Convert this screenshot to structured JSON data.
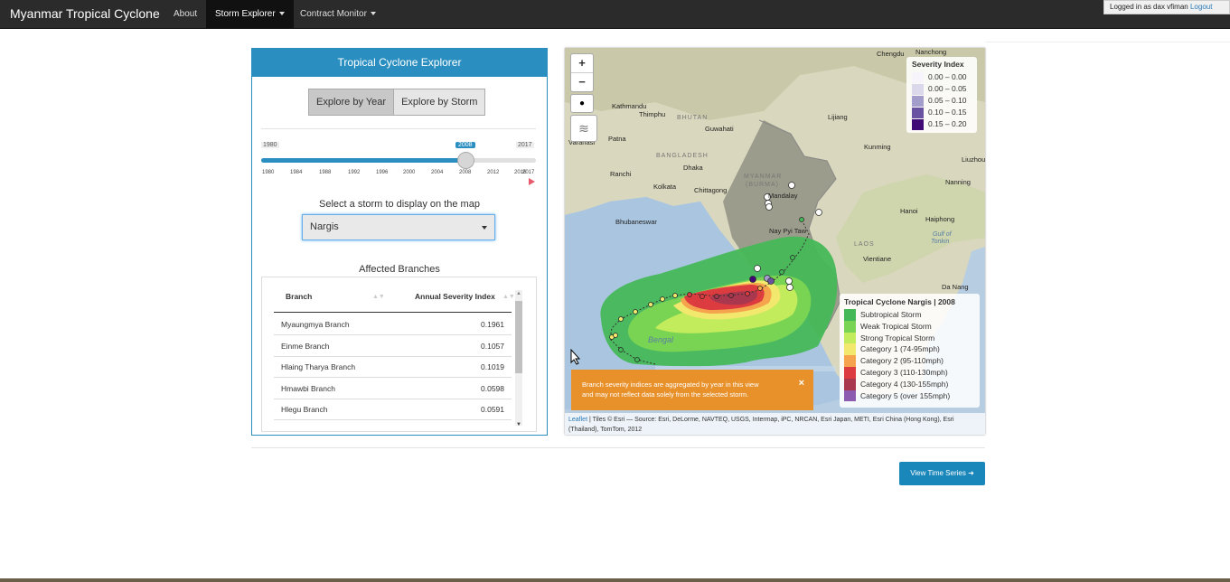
{
  "navbar": {
    "brand": "Myanmar Tropical Cyclone",
    "items": [
      {
        "label": "About"
      },
      {
        "label": "Storm Explorer"
      },
      {
        "label": "Contract Monitor"
      }
    ],
    "user_text": "Logged in as dax vfiman",
    "logout_label": "Logout"
  },
  "explorer": {
    "title": "Tropical Cyclone Explorer",
    "mode_year": "Explore by Year",
    "mode_storm": "Explore by Storm",
    "slider": {
      "min": "1980",
      "max": "2017",
      "value": "2008",
      "ticks": [
        "1980",
        "1984",
        "1988",
        "1992",
        "1996",
        "2000",
        "2004",
        "2008",
        "2012",
        "2016",
        "2017"
      ]
    },
    "select_label": "Select a storm to display on the map",
    "selected_storm": "Nargis",
    "affected_label": "Affected Branches",
    "table": {
      "col_branch": "Branch",
      "col_index": "Annual Severity Index",
      "rows": [
        {
          "branch": "Myaungmya Branch",
          "index": "0.1961"
        },
        {
          "branch": "Einme Branch",
          "index": "0.1057"
        },
        {
          "branch": "Hlaing Tharya Branch",
          "index": "0.1019"
        },
        {
          "branch": "Hmawbi Branch",
          "index": "0.0598"
        },
        {
          "branch": "Hlegu Branch",
          "index": "0.0591"
        }
      ]
    }
  },
  "map": {
    "zoom_in": "+",
    "zoom_out": "−",
    "labels": {
      "chengdu": "Chengdu",
      "nanchong": "Nanchong",
      "kathmandu": "Kathmandu",
      "thimphu": "Thimphu",
      "bhutan": "BHUTAN",
      "lijiang": "Lijiang",
      "guwahati": "Guwahati",
      "varanasi": "Varanasi",
      "patna": "Patna",
      "bangladesh": "BANGLADESH",
      "kunming": "Kunming",
      "liuzhou": "Liuzhou",
      "ranchi": "Ranchi",
      "dhaka": "Dhaka",
      "myanmar": "MYANMAR",
      "burma": "(BURMA)",
      "kolkata": "Kolkata",
      "chittagong": "Chittagong",
      "mandalay": "Mandalay",
      "nanning": "Nanning",
      "bhubaneswar": "Bhubaneswar",
      "hanoi": "Hanoi",
      "haiphong": "Haiphong",
      "gulf1": "Gulf of",
      "gulf2": "Tonkin",
      "naypyitaw": "Nay Pyi Taw",
      "laos": "LAOS",
      "vientiane": "Vientiane",
      "danang": "Da Nang",
      "bengal": "Bengal"
    },
    "severity_legend": {
      "title": "Severity Index",
      "items": [
        {
          "label": "0.00 – 0.00",
          "color": "#f7f5fb"
        },
        {
          "label": "0.00 – 0.05",
          "color": "#dcd8eb"
        },
        {
          "label": "0.05 – 0.10",
          "color": "#a29dcb"
        },
        {
          "label": "0.10 – 0.15",
          "color": "#6a52a3"
        },
        {
          "label": "0.15 – 0.20",
          "color": "#3f0a76"
        }
      ]
    },
    "storm_legend": {
      "title": "Tropical Cyclone Nargis | 2008",
      "items": [
        {
          "label": "Subtropical Storm",
          "color": "#44b857"
        },
        {
          "label": "Weak Tropical Storm",
          "color": "#7ad454"
        },
        {
          "label": "Strong Tropical Storm",
          "color": "#c3ec5d"
        },
        {
          "label": "Category 1 (74-95mph)",
          "color": "#f2e86e"
        },
        {
          "label": "Category 2 (95-110mph)",
          "color": "#f5a34c"
        },
        {
          "label": "Category 3 (110-130mph)",
          "color": "#dc3b3f"
        },
        {
          "label": "Category 4 (130-155mph)",
          "color": "#a9384e"
        },
        {
          "label": "Category 5 (over 155mph)",
          "color": "#8c5bb0"
        }
      ]
    },
    "alert": {
      "line1": "Branch severity indices are aggregated by year in this view",
      "line2": "and may not reflect data solely from the selected storm.",
      "close": "×"
    },
    "attribution": {
      "leaflet": "Leaflet",
      "text": " | Tiles © Esri — Source: Esri, DeLorme, NAVTEQ, USGS, Intermap, iPC, NRCAN, Esri Japan, METI, Esri China (Hong Kong), Esri (Thailand), TomTom, 2012"
    }
  },
  "actions": {
    "view_time_series": "View Time Series"
  },
  "colors": {
    "primary": "#2a8fc0",
    "navbar": "#2b2b2b",
    "alert": "#e8912b",
    "button": "#1a87ba"
  }
}
